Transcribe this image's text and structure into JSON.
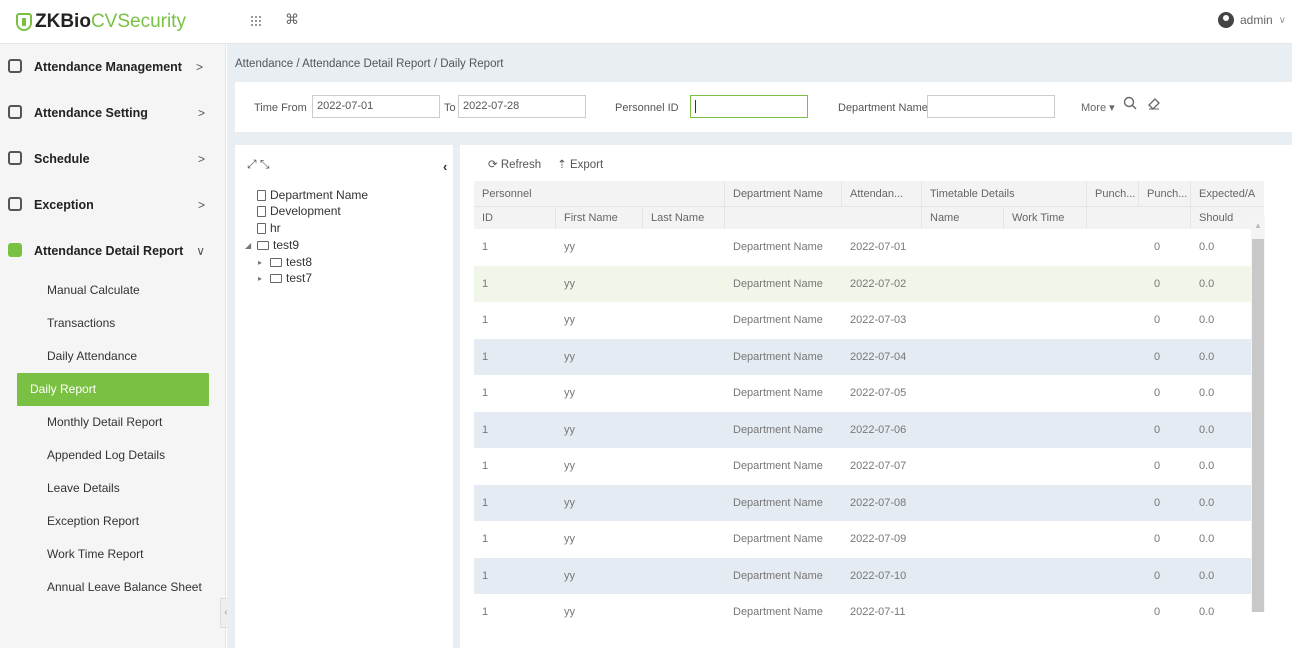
{
  "app": {
    "logo_prefix": "ZKBio",
    "logo_rest": " CVSecurity",
    "user": "admin"
  },
  "topbar": {
    "grid_icon": "grid-icon",
    "cmd_icon": "⌘"
  },
  "sidebar": {
    "menus": [
      {
        "label": "Attendance Management",
        "arrow": ">"
      },
      {
        "label": "Attendance Setting",
        "arrow": ">"
      },
      {
        "label": "Schedule",
        "arrow": ">"
      },
      {
        "label": "Exception",
        "arrow": ">"
      },
      {
        "label": "Attendance Detail Report",
        "arrow": "∨"
      }
    ],
    "items": [
      "Manual Calculate",
      "Transactions",
      "Daily Attendance",
      "Daily Report",
      "Monthly Detail Report",
      "Appended Log Details",
      "Leave Details",
      "Exception Report",
      "Work Time Report",
      "Annual Leave Balance Sheet"
    ],
    "active_item": "Daily Report",
    "collapse_glyph": "«"
  },
  "breadcrumb": "Attendance / Attendance Detail Report / Daily Report",
  "filters": {
    "time_from_label": "Time From",
    "time_from_value": "2022-07-01",
    "to_label": "To",
    "to_value": "2022-07-28",
    "personnel_id_label": "Personnel ID",
    "personnel_id_value": "",
    "department_label": "Department Name",
    "department_value": "",
    "more_label": "More ▾"
  },
  "tree": {
    "tools": "⤢ ⤡",
    "collapse": "‹",
    "nodes": [
      {
        "label": "Department Name"
      },
      {
        "label": "Development"
      },
      {
        "label": "hr"
      },
      {
        "label": "test9",
        "toggle": "◢"
      },
      {
        "label": "test8",
        "toggle": "▸"
      },
      {
        "label": "test7",
        "toggle": "▸"
      }
    ]
  },
  "grid": {
    "toolbar": {
      "refresh": "⟳ Refresh",
      "export": "⇡ Export"
    },
    "group_headers": [
      "Personnel",
      "Department Name",
      "Attendan...",
      "Timetable Details",
      "Punch...",
      "Punch...",
      "Expected/A"
    ],
    "sub_headers": [
      "ID",
      "First Name",
      "Last Name",
      "Name",
      "Work Time",
      "Should"
    ],
    "rows": [
      {
        "id": "1",
        "first": "yy",
        "dept": "Department Name",
        "date": "2022-07-01",
        "punch": "0",
        "should": "0.0"
      },
      {
        "id": "1",
        "first": "yy",
        "dept": "Department Name",
        "date": "2022-07-02",
        "punch": "0",
        "should": "0.0"
      },
      {
        "id": "1",
        "first": "yy",
        "dept": "Department Name",
        "date": "2022-07-03",
        "punch": "0",
        "should": "0.0"
      },
      {
        "id": "1",
        "first": "yy",
        "dept": "Department Name",
        "date": "2022-07-04",
        "punch": "0",
        "should": "0.0"
      },
      {
        "id": "1",
        "first": "yy",
        "dept": "Department Name",
        "date": "2022-07-05",
        "punch": "0",
        "should": "0.0"
      },
      {
        "id": "1",
        "first": "yy",
        "dept": "Department Name",
        "date": "2022-07-06",
        "punch": "0",
        "should": "0.0"
      },
      {
        "id": "1",
        "first": "yy",
        "dept": "Department Name",
        "date": "2022-07-07",
        "punch": "0",
        "should": "0.0"
      },
      {
        "id": "1",
        "first": "yy",
        "dept": "Department Name",
        "date": "2022-07-08",
        "punch": "0",
        "should": "0.0"
      },
      {
        "id": "1",
        "first": "yy",
        "dept": "Department Name",
        "date": "2022-07-09",
        "punch": "0",
        "should": "0.0"
      },
      {
        "id": "1",
        "first": "yy",
        "dept": "Department Name",
        "date": "2022-07-10",
        "punch": "0",
        "should": "0.0"
      },
      {
        "id": "1",
        "first": "yy",
        "dept": "Department Name",
        "date": "2022-07-11",
        "punch": "0",
        "should": "0.0"
      }
    ]
  },
  "colors": {
    "accent": "#7ac143",
    "row_alt": "#e5ebf2",
    "row_hover": "#f0f7e9"
  }
}
